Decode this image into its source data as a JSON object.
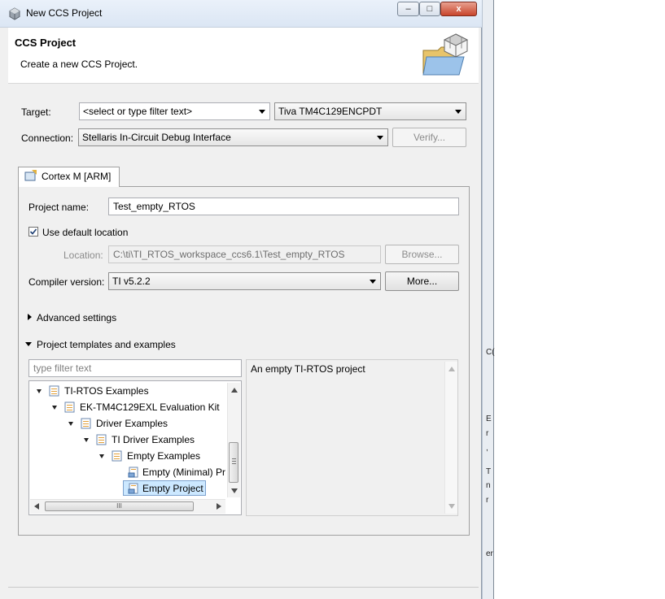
{
  "window": {
    "title": "New CCS Project",
    "controls": {
      "minimize": "–",
      "maximize": "□",
      "close": "x"
    }
  },
  "banner": {
    "title": "CCS Project",
    "description": "Create a new CCS Project."
  },
  "target": {
    "label": "Target:",
    "filter_placeholder": "<select or type filter text>",
    "device": "Tiva TM4C129ENCPDT"
  },
  "connection": {
    "label": "Connection:",
    "value": "Stellaris In-Circuit Debug Interface",
    "verify_label": "Verify..."
  },
  "tab": {
    "label": "Cortex M [ARM]"
  },
  "project": {
    "name_label": "Project name:",
    "name_value": "Test_empty_RTOS",
    "use_default_location_label": "Use default location",
    "location_label": "Location:",
    "location_value": "C:\\ti\\TI_RTOS_workspace_ccs6.1\\Test_empty_RTOS",
    "browse_label": "Browse...",
    "compiler_label": "Compiler version:",
    "compiler_value": "TI v5.2.2",
    "more_label": "More..."
  },
  "sections": {
    "advanced": "Advanced settings",
    "templates": "Project templates and examples"
  },
  "templates": {
    "filter_placeholder": "type filter text",
    "tree": [
      {
        "label": "TI-RTOS Examples"
      },
      {
        "label": "EK-TM4C129EXL Evaluation Kit"
      },
      {
        "label": "Driver Examples"
      },
      {
        "label": "TI Driver Examples"
      },
      {
        "label": "Empty Examples"
      },
      {
        "label": "Empty (Minimal) Pr"
      },
      {
        "label": "Empty Project"
      }
    ],
    "description": "An empty TI-RTOS project",
    "hscroll_grip": "III"
  },
  "background": {
    "fragments": [
      "C(",
      "E",
      "r",
      ",",
      "T",
      "n",
      "r"
    ],
    "bottom_fragment": "er"
  }
}
